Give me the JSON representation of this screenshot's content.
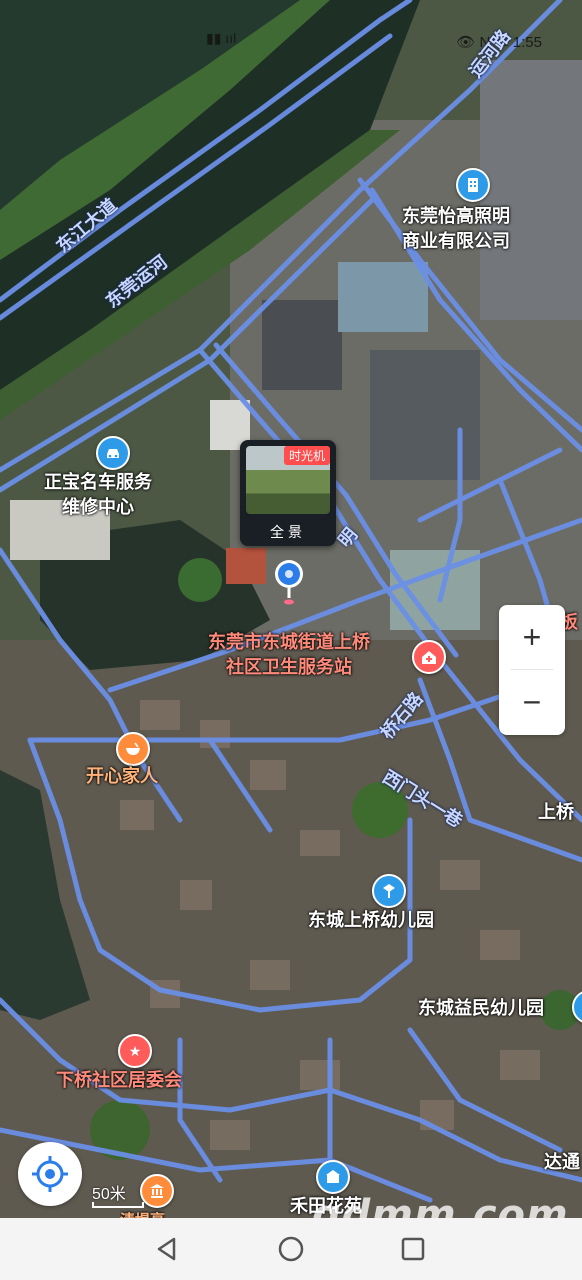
{
  "status_bar": {
    "left_text": "▮▮ ııl",
    "right_text": "👁 N ▭ 1:55"
  },
  "map": {
    "road_labels": {
      "dongjiang": "东江大道",
      "canal": "东莞运河",
      "yunhe_road": "运河路",
      "qiaoshi": "桥石路",
      "xiaxia": "西门头一巷",
      "ming": "明"
    },
    "pois": {
      "lighting_company": "东莞怡高照明\n商业有限公司",
      "car_service": "正宝名车服务\n维修中心",
      "health_station": "东莞市东城街道上桥\n社区卫生服务站",
      "kaixin": "开心家人",
      "kindergarten_shangqiao": "东城上桥幼儿园",
      "kindergarten_yimin": "东城益民幼儿园",
      "xiaqiao_committee": "下桥社区居委会",
      "shangqiao": "上桥",
      "he_tian": "禾田花苑",
      "datong": "达通",
      "right_edge": "板",
      "bottom_small": "清堤亭"
    },
    "panorama": {
      "badge": "时光机",
      "label": "全景"
    },
    "scale_label": "50米"
  },
  "controls": {
    "zoom_in": "+",
    "zoom_out": "−"
  },
  "watermark": "gdmm.com",
  "icons": {
    "building": "building-icon",
    "car": "car-icon",
    "hospital": "hospital-icon",
    "restaurant": "bowl-icon",
    "school": "school-icon",
    "flag": "star-icon",
    "museum": "museum-icon",
    "locate": "locate-icon"
  }
}
